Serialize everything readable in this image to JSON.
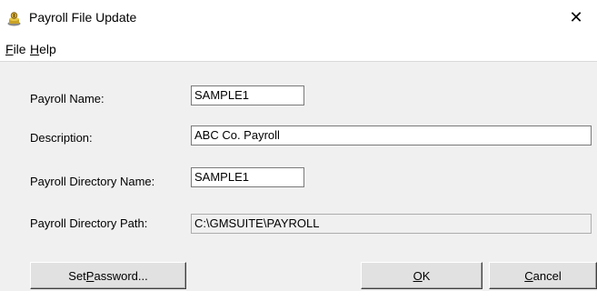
{
  "window": {
    "title": "Payroll File Update",
    "close_glyph": "✕"
  },
  "menu": {
    "file": {
      "accel": "F",
      "rest": "ile"
    },
    "help": {
      "accel": "H",
      "rest": "elp"
    }
  },
  "form": {
    "payroll_name_label": "Payroll Name:",
    "payroll_name_value": "SAMPLE1",
    "description_label": "Description:",
    "description_value": "ABC Co. Payroll",
    "directory_name_label": "Payroll Directory Name:",
    "directory_name_value": "SAMPLE1",
    "directory_path_label": "Payroll Directory Path:",
    "directory_path_value": "C:\\GMSUITE\\PAYROLL"
  },
  "buttons": {
    "set_password": {
      "before": "Set ",
      "accel": "P",
      "after": "assword..."
    },
    "ok": {
      "before": "",
      "accel": "O",
      "after": "K"
    },
    "cancel": {
      "before": "",
      "accel": "C",
      "after": "ancel"
    }
  }
}
